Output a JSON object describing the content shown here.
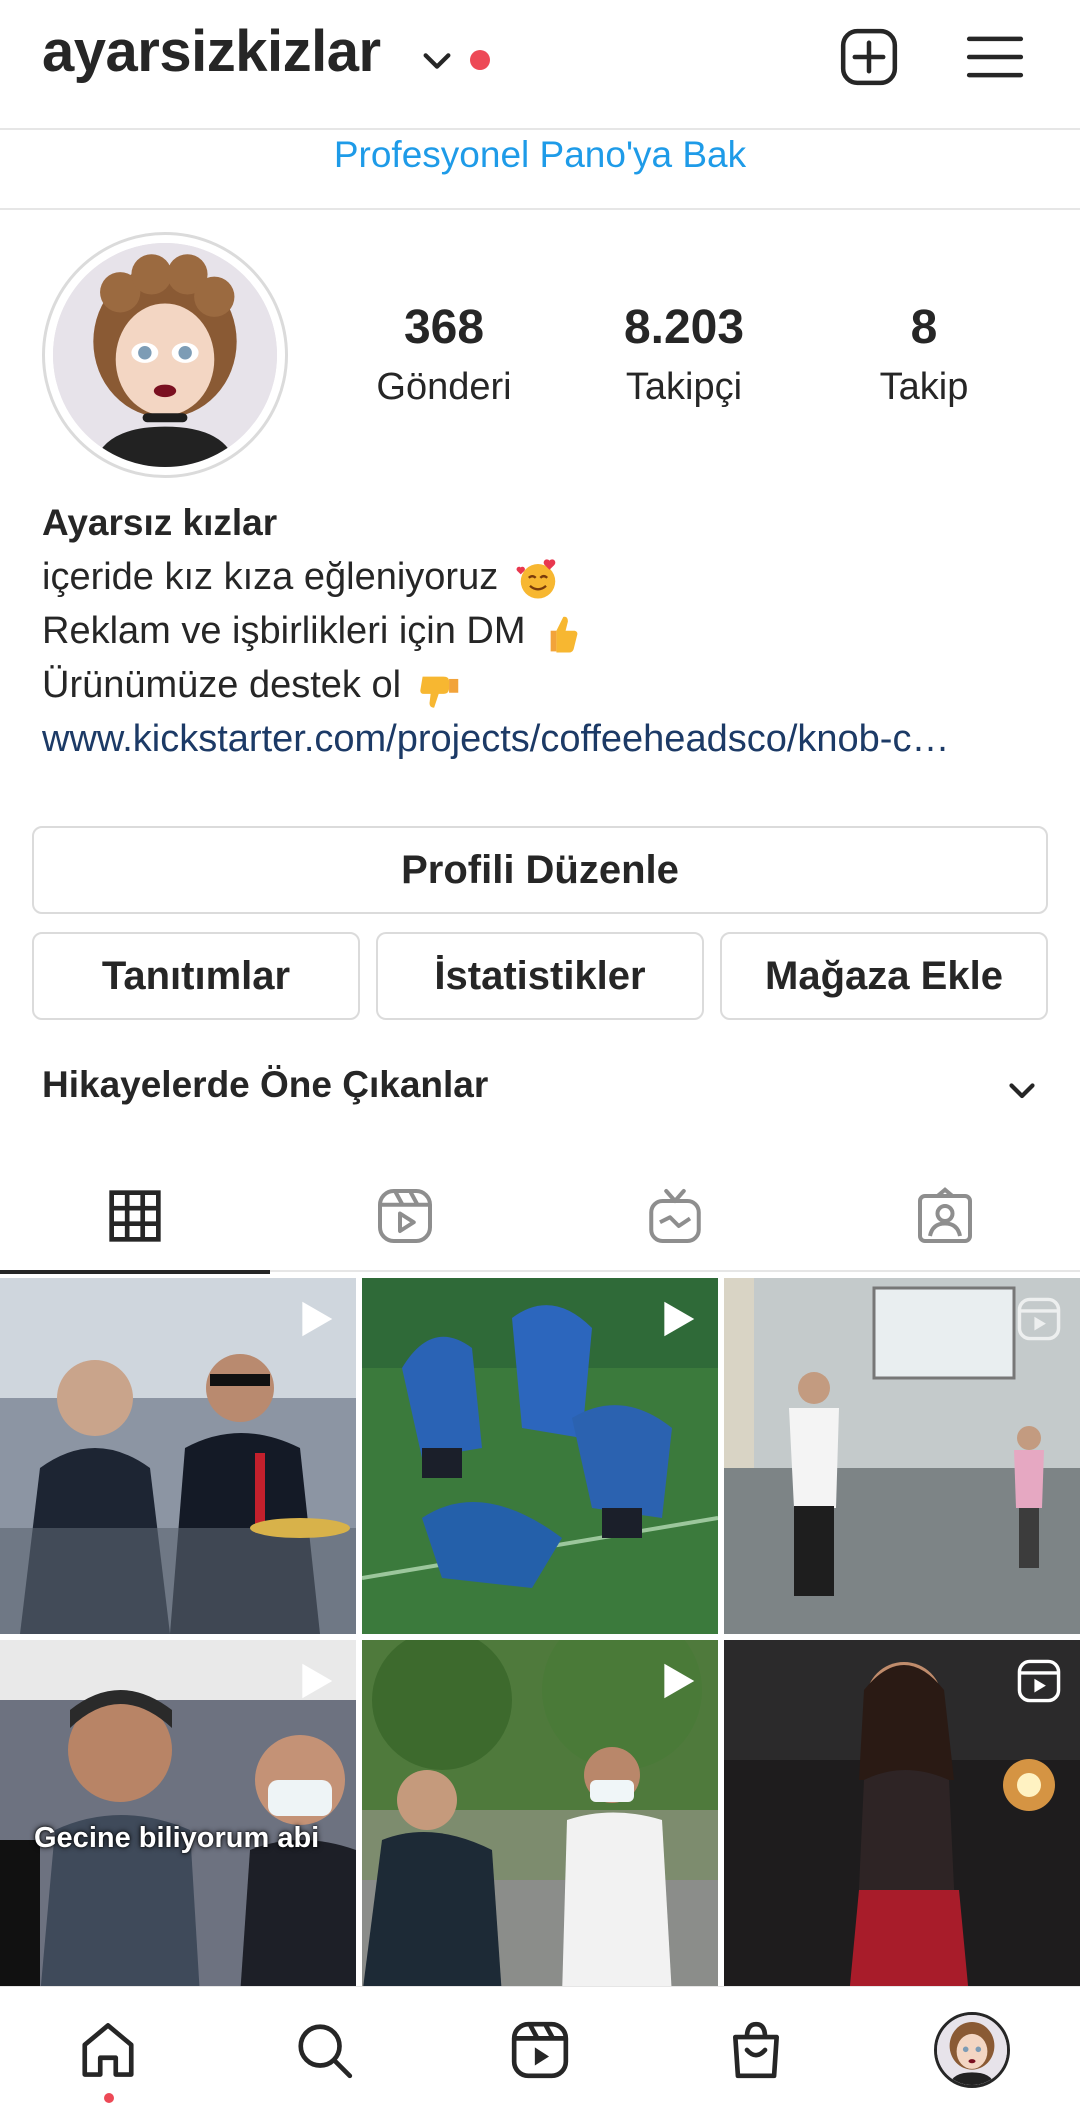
{
  "header": {
    "username": "ayarsizkizlar",
    "has_notification": true
  },
  "professional": {
    "dashboard_link": "Profesyonel Pano'ya Bak"
  },
  "profile": {
    "stats": [
      {
        "value": "368",
        "label": "Gönderi"
      },
      {
        "value": "8.203",
        "label": "Takipçi"
      },
      {
        "value": "8",
        "label": "Takip"
      }
    ],
    "bio": {
      "name": "Ayarsız kızlar",
      "lines": [
        "içeride kız kıza eğleniyoruz",
        "Reklam ve işbirlikleri için DM",
        "Ürünümüze destek ol"
      ],
      "link": "www.kickstarter.com/projects/coffeeheadsco/knob-c…"
    }
  },
  "buttons": {
    "edit_profile": "Profili Düzenle",
    "promotions": "Tanıtımlar",
    "insights": "İstatistikler",
    "add_shop": "Mağaza Ekle"
  },
  "highlights": {
    "title": "Hikayelerde Öne Çıkanlar"
  },
  "tabs": [
    {
      "icon": "grid-icon",
      "active": true
    },
    {
      "icon": "reels-icon",
      "active": false
    },
    {
      "icon": "igtv-icon",
      "active": false
    },
    {
      "icon": "tagged-icon",
      "active": false
    }
  ],
  "posts": [
    {
      "type": "video"
    },
    {
      "type": "video"
    },
    {
      "type": "reel"
    },
    {
      "type": "video"
    },
    {
      "type": "video"
    },
    {
      "type": "reel",
      "caption_in_image": ""
    }
  ],
  "post_caption_overlay": "Gecine biliyorum abi",
  "bottom_nav": [
    {
      "icon": "home-icon",
      "active": true
    },
    {
      "icon": "search-icon"
    },
    {
      "icon": "reels-icon"
    },
    {
      "icon": "shop-icon"
    },
    {
      "icon": "profile-avatar"
    }
  ],
  "colors": {
    "link_blue": "#1e9be8",
    "notification_red": "#ed4956",
    "text": "#262626",
    "border": "#dbdbdb"
  }
}
